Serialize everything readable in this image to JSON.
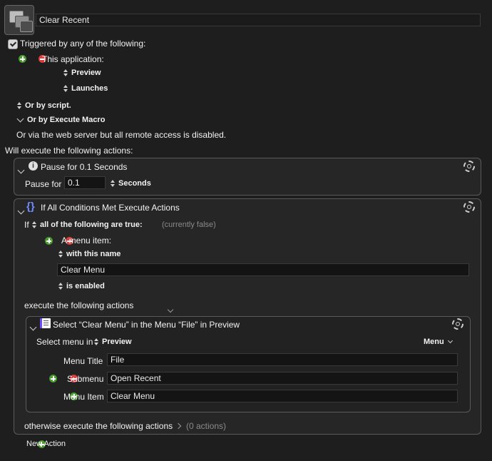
{
  "macro": {
    "name": "Clear Recent"
  },
  "trigger": {
    "triggered_by_label": "Triggered by any of the following:",
    "this_application_label": "This application:",
    "app_value": "Preview",
    "event_value": "Launches",
    "or_by_script": "Or by script.",
    "or_by_execute_macro": "Or by Execute Macro",
    "web_server_note": "Or via the web server but all remote access is disabled."
  },
  "actions_header": "Will execute the following actions:",
  "pause_action": {
    "title": "Pause for 0.1 Seconds",
    "pause_label": "Pause for",
    "pause_value": "0.1",
    "unit": "Seconds"
  },
  "if_action": {
    "title": "If All Conditions Met Execute Actions",
    "if_label": "If",
    "condition_mode": "all of the following are true:",
    "condition_state": "(currently false)",
    "condition_type": "A menu item:",
    "match_mode": "with this name",
    "menu_name_value": "Clear Menu",
    "enabled_state": "is enabled",
    "execute_label": "execute the following actions",
    "otherwise_label": "otherwise execute the following actions",
    "otherwise_count": "(0 actions)"
  },
  "select_menu_action": {
    "title": "Select “Clear Menu” in the Menu “File” in Preview",
    "select_in_label": "Select menu in",
    "select_in_value": "Preview",
    "menu_mode": "Menu",
    "menu_title_label": "Menu Title",
    "menu_title_value": "File",
    "submenu_label": "Submenu",
    "submenu_value": "Open Recent",
    "menu_item_label": "Menu Item",
    "menu_item_value": "Clear Menu"
  },
  "footer": {
    "new_action_label": "New Action"
  }
}
